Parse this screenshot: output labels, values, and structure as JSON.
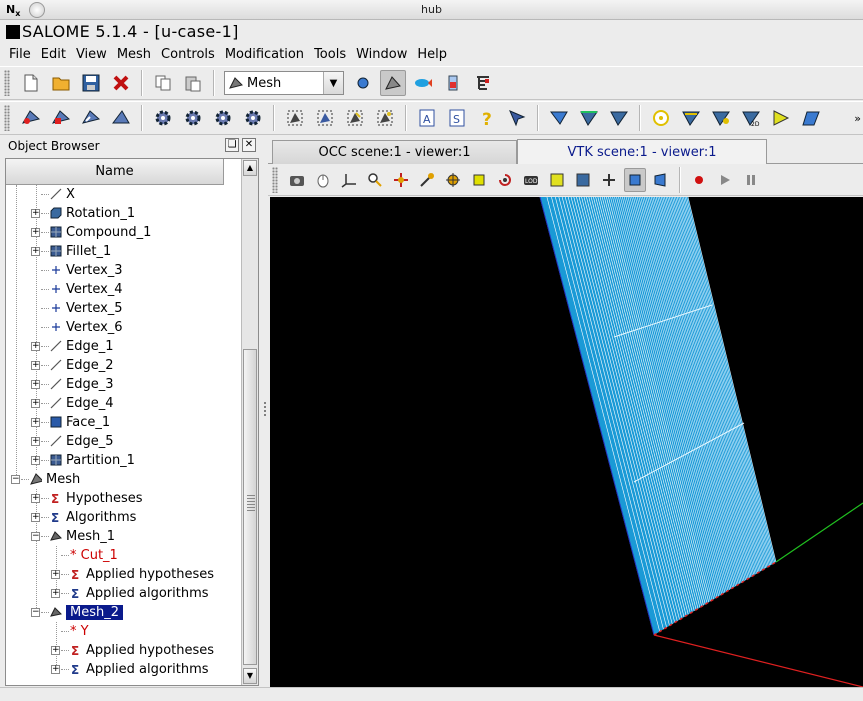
{
  "window": {
    "wm_title": "hub",
    "app_title": "SALOME 5.1.4 - [u-case-1]"
  },
  "menu": [
    "File",
    "Edit",
    "View",
    "Mesh",
    "Controls",
    "Modification",
    "Tools",
    "Window",
    "Help"
  ],
  "toolbar": {
    "module_combo": "Mesh",
    "more": "»"
  },
  "object_browser": {
    "title": "Object Browser",
    "column_header": "Name",
    "items": [
      {
        "label": "X",
        "icon": "edge-icon"
      },
      {
        "label": "Rotation_1",
        "icon": "solid-icon"
      },
      {
        "label": "Compound_1",
        "icon": "compound-icon"
      },
      {
        "label": "Fillet_1",
        "icon": "compound-icon"
      },
      {
        "label": "Vertex_3",
        "icon": "vertex-icon"
      },
      {
        "label": "Vertex_4",
        "icon": "vertex-icon"
      },
      {
        "label": "Vertex_5",
        "icon": "vertex-icon"
      },
      {
        "label": "Vertex_6",
        "icon": "vertex-icon"
      },
      {
        "label": "Edge_1",
        "icon": "edge-icon"
      },
      {
        "label": "Edge_2",
        "icon": "edge-icon"
      },
      {
        "label": "Edge_3",
        "icon": "edge-icon"
      },
      {
        "label": "Edge_4",
        "icon": "edge-icon"
      },
      {
        "label": "Face_1",
        "icon": "face-icon"
      },
      {
        "label": "Edge_5",
        "icon": "edge-icon"
      },
      {
        "label": "Partition_1",
        "icon": "compound-icon"
      },
      {
        "label": "Mesh",
        "icon": "mesh-module-icon"
      },
      {
        "label": "Hypotheses",
        "icon": "hypothesis-icon"
      },
      {
        "label": "Algorithms",
        "icon": "algorithm-icon"
      },
      {
        "label": "Mesh_1",
        "icon": "mesh-icon"
      },
      {
        "label": "* Cut_1",
        "icon": ""
      },
      {
        "label": "Applied hypotheses",
        "icon": "hypothesis-icon"
      },
      {
        "label": "Applied algorithms",
        "icon": "algorithm-icon"
      },
      {
        "label": "Mesh_2",
        "icon": "mesh-icon"
      },
      {
        "label": "* Y",
        "icon": ""
      },
      {
        "label": "Applied hypotheses",
        "icon": "hypothesis-icon"
      },
      {
        "label": "Applied algorithms",
        "icon": "algorithm-icon"
      }
    ]
  },
  "viewer": {
    "tabs": [
      "OCC scene:1 - viewer:1",
      "VTK scene:1 - viewer:1"
    ],
    "active_tab": 1
  },
  "colors": {
    "selection": "#0a1a8c",
    "mesh": "#1a9ad6",
    "axis_x": "#e02020",
    "axis_y": "#20c020",
    "background": "#000000"
  }
}
